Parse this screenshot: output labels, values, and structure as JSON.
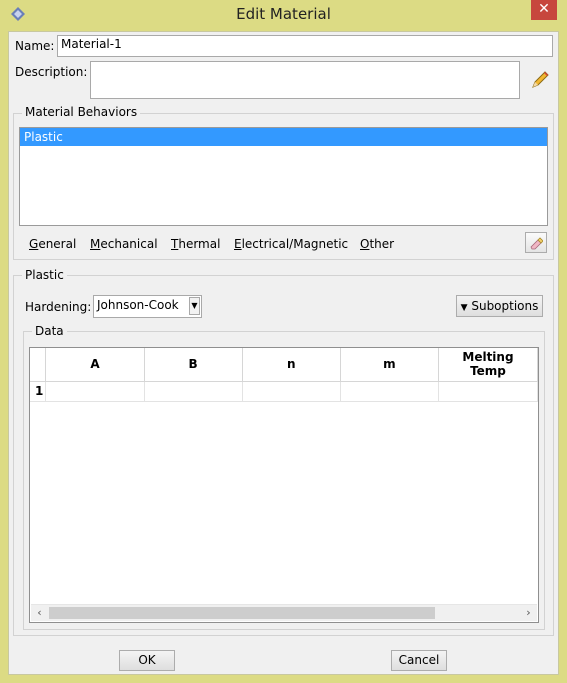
{
  "window": {
    "title": "Edit Material",
    "close_glyph": "✕"
  },
  "name": {
    "label": "Name:",
    "value": "Material-1"
  },
  "description": {
    "label": "Description:",
    "value": ""
  },
  "material_behaviors": {
    "title": "Material Behaviors",
    "items": [
      {
        "label": "Plastic",
        "selected": true
      }
    ],
    "menu": [
      {
        "mnemonic": "G",
        "rest": "eneral"
      },
      {
        "mnemonic": "M",
        "rest": "echanical"
      },
      {
        "mnemonic": "T",
        "rest": "hermal"
      },
      {
        "mnemonic": "E",
        "rest": "lectrical/Magnetic"
      },
      {
        "mnemonic": "O",
        "rest": "ther"
      }
    ]
  },
  "plastic": {
    "title": "Plastic",
    "hardening_label": "Hardening:",
    "hardening_value": "Johnson-Cook",
    "suboptions_label": "Suboptions",
    "data_title": "Data",
    "columns": [
      "A",
      "B",
      "n",
      "m",
      "Melting\nTemp"
    ],
    "rows": [
      {
        "index": "1",
        "cells": [
          "",
          "",
          "",
          "",
          ""
        ]
      }
    ]
  },
  "buttons": {
    "ok": "OK",
    "cancel": "Cancel"
  },
  "icons": {
    "app": "abaqus-diamond-icon",
    "edit": "pencil-icon",
    "delete": "eraser-icon"
  },
  "colors": {
    "selection": "#3399ff",
    "title_bar": "#dcdb84",
    "close": "#c7463d"
  }
}
